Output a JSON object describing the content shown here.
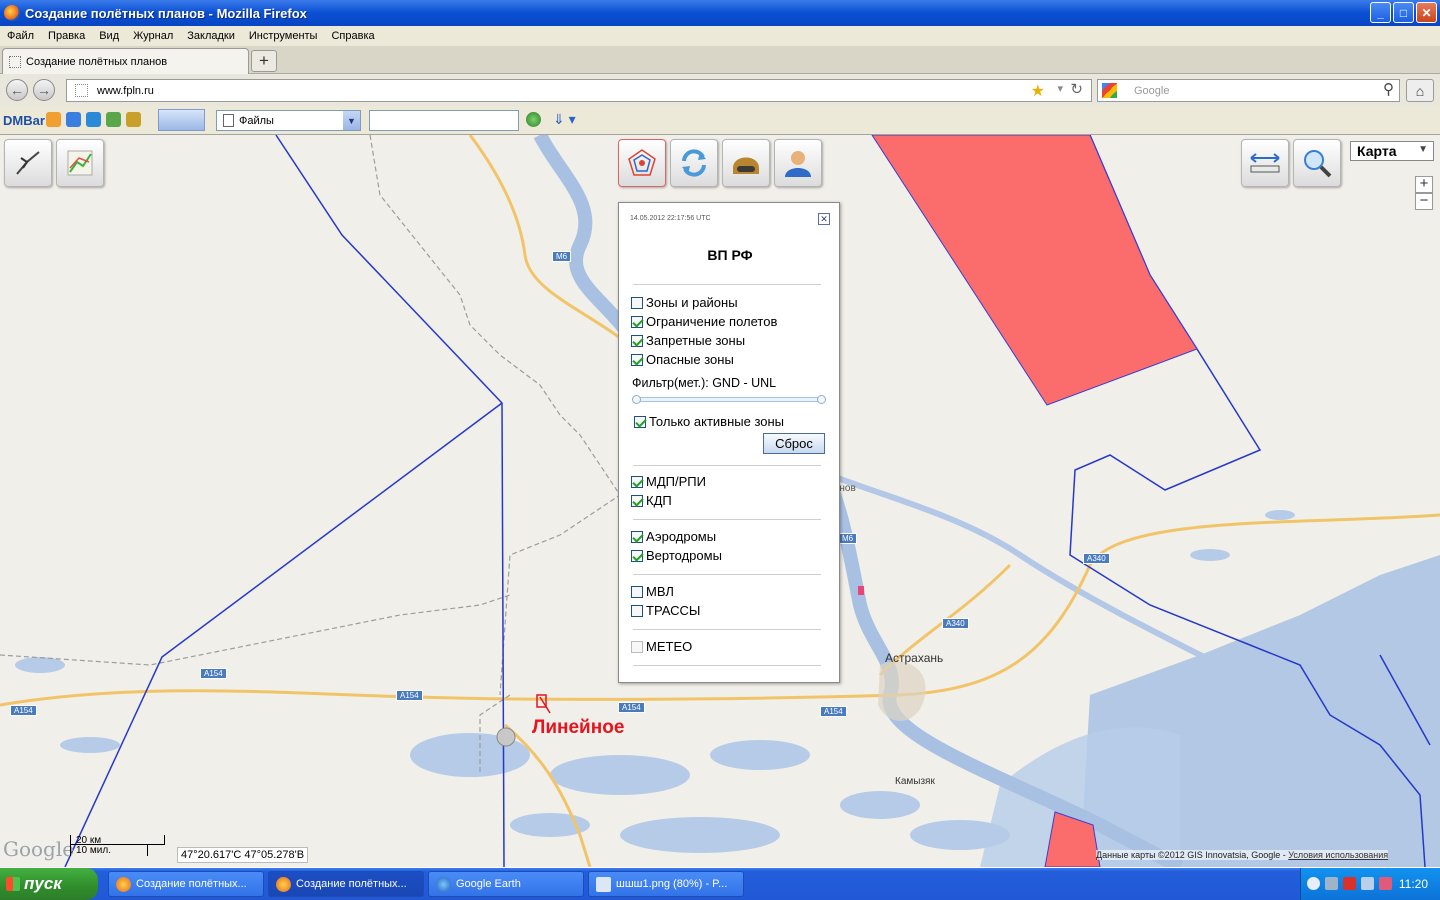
{
  "window": {
    "title": "Создание полётных планов - Mozilla Firefox",
    "min": "_",
    "max": "□",
    "close": "✕"
  },
  "menu": [
    "Файл",
    "Правка",
    "Вид",
    "Журнал",
    "Закладки",
    "Инструменты",
    "Справка"
  ],
  "tab": {
    "label": "Создание полётных планов",
    "new": "+"
  },
  "nav": {
    "back": "←",
    "forward": "→",
    "url": "www.fpln.ru",
    "search_placeholder": "Google",
    "home": "⌂",
    "star": "★",
    "reload": "↻",
    "drop": "▾",
    "magnifier": "⚲"
  },
  "dmbar": {
    "logo": "DMBar",
    "select_value": "Файлы",
    "download": "⇓ ▾"
  },
  "map": {
    "type_select": "Карта",
    "zoom_in": "+",
    "zoom_out": "−",
    "coords": "47°20.617'С 47°05.278'В",
    "scale_km": "20 км",
    "scale_mi": "10 мил.",
    "google_logo": "Google",
    "copyright": "Данные карты ©2012 GIS Innovatsia, Google - ",
    "terms": "Условия использования",
    "city_astrakhan": "Астрахань",
    "city_kamyzyak": "Камызяк",
    "city_narimanov": "Нариманов",
    "marker_label": "Линейное",
    "roads": {
      "m6a": "M6",
      "m6b": "M6",
      "a154a": "A154",
      "a154b": "A154",
      "a154c": "A154",
      "a154d": "A154",
      "a154e": "A154",
      "a340a": "A340",
      "a340b": "A340"
    }
  },
  "panel": {
    "timestamp": "14.05.2012 22:17:56 UTC",
    "close": "✕",
    "title": "ВП РФ",
    "zones": [
      {
        "label": "Зоны и районы",
        "checked": false
      },
      {
        "label": "Ограничение полетов",
        "checked": true
      },
      {
        "label": "Запретные зоны",
        "checked": true
      },
      {
        "label": "Опасные зоны",
        "checked": true
      }
    ],
    "filter_label": "Фильтр(мет.): GND - UNL",
    "active_only": "Только активные зоны",
    "reset": "Сброс",
    "mdp": "МДП/РПИ",
    "kdp": "КДП",
    "aero": "Аэродромы",
    "heli": "Вертодромы",
    "mvl": "МВЛ",
    "trassy": "ТРАССЫ",
    "meteo": "МЕТЕО"
  },
  "taskbar": {
    "start": "пуск",
    "tasks": [
      "Создание полётных...",
      "Создание полётных...",
      "Google Earth",
      "шшш1.png (80%) - P..."
    ],
    "clock": "11:20"
  }
}
